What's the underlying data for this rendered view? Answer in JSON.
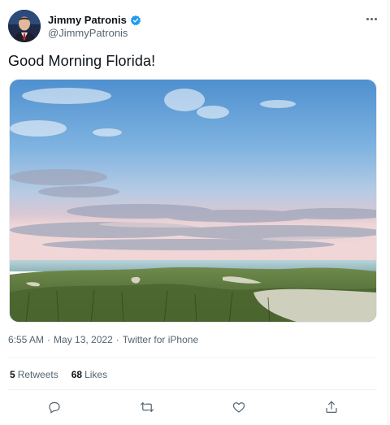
{
  "author": {
    "name": "Jimmy Patronis",
    "handle": "@JimmyPatronis",
    "verified": true
  },
  "tweet": {
    "text": "Good Morning Florida!",
    "time": "6:55 AM",
    "date": "May 13, 2022",
    "source": "Twitter for iPhone",
    "separator": "·"
  },
  "stats": {
    "retweets_count": "5",
    "retweets_label": "Retweets",
    "likes_count": "68",
    "likes_label": "Likes"
  },
  "icons": {
    "more": "more-dots-icon",
    "verified": "verified-badge-icon",
    "reply": "reply-icon",
    "retweet": "retweet-icon",
    "like": "heart-icon",
    "share": "share-icon"
  },
  "colors": {
    "verified": "#1d9bf0",
    "secondary_text": "#536471",
    "primary_text": "#0f1419"
  }
}
